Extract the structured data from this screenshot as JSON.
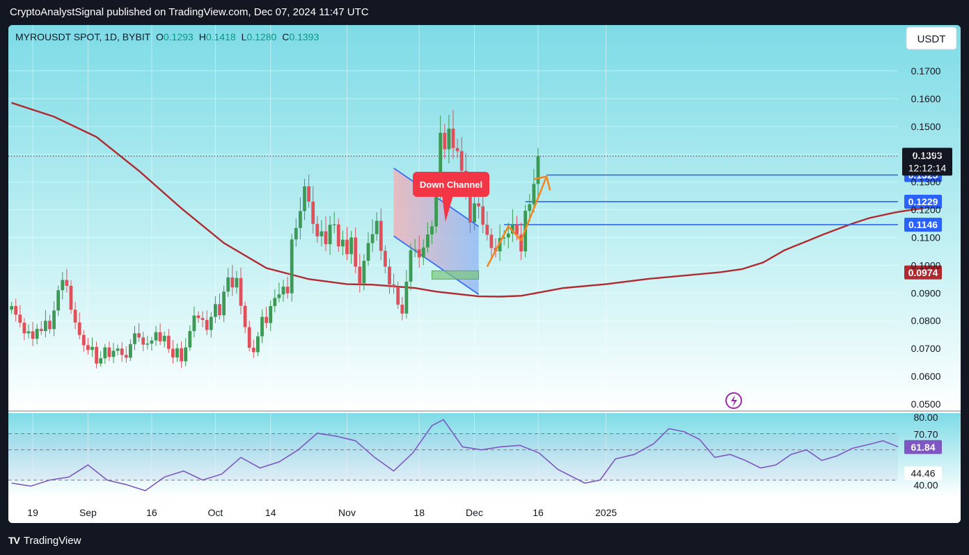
{
  "header": {
    "text": "CryptoAnalystSignal published on TradingView.com, Dec 07, 2024 11:47 UTC"
  },
  "footer": {
    "brand": "TradingView"
  },
  "legend": {
    "symbol": "MYROUSDT SPOT, 1D, BYBIT",
    "o_label": "O",
    "o_value": "0.1293",
    "h_label": "H",
    "h_value": "0.1418",
    "l_label": "L",
    "l_value": "0.1280",
    "c_label": "C",
    "c_value": "0.1393"
  },
  "currency_button": "USDT",
  "annotation_label": "Down Channel",
  "colors": {
    "bull": "#26a69a",
    "bull_dark": "#3c9a55",
    "bear": "#e0505a",
    "ma": "#b02a30",
    "level": "#2962ff",
    "arrow": "#f5851f",
    "rsi": "#7e57c2"
  },
  "chart_data": {
    "type": "candlestick",
    "price_axis": {
      "ylim": [
        0.048,
        0.182
      ],
      "ticks": [
        "0.0500",
        "0.0600",
        "0.0700",
        "0.0800",
        "0.0900",
        "0.1000",
        "0.1100",
        "0.1200",
        "0.1300",
        "0.1400",
        "0.1500",
        "0.1600",
        "0.1700"
      ]
    },
    "time_axis": {
      "labels": [
        {
          "text": "19",
          "date": "2024-08-19"
        },
        {
          "text": "Sep",
          "date": "2024-09-01"
        },
        {
          "text": "16",
          "date": "2024-09-16"
        },
        {
          "text": "Oct",
          "date": "2024-10-01"
        },
        {
          "text": "14",
          "date": "2024-10-14"
        },
        {
          "text": "Nov",
          "date": "2024-11-01"
        },
        {
          "text": "18",
          "date": "2024-11-18"
        },
        {
          "text": "Dec",
          "date": "2024-12-01"
        },
        {
          "text": "16",
          "date": "2024-12-16"
        },
        {
          "text": "2025",
          "date": "2025-01-01"
        }
      ]
    },
    "closes": [
      0.0853,
      0.0822,
      0.0793,
      0.0755,
      0.0762,
      0.0735,
      0.0771,
      0.0763,
      0.08,
      0.077,
      0.0837,
      0.091,
      0.0947,
      0.0926,
      0.084,
      0.0794,
      0.0749,
      0.0712,
      0.0695,
      0.0706,
      0.0646,
      0.0665,
      0.0704,
      0.067,
      0.0692,
      0.07,
      0.0677,
      0.0667,
      0.0716,
      0.0755,
      0.074,
      0.0714,
      0.0718,
      0.0729,
      0.0759,
      0.0726,
      0.0746,
      0.0699,
      0.0668,
      0.0701,
      0.0654,
      0.0704,
      0.0763,
      0.0819,
      0.081,
      0.0803,
      0.0767,
      0.0814,
      0.086,
      0.082,
      0.0905,
      0.0956,
      0.092,
      0.0954,
      0.0854,
      0.0777,
      0.0703,
      0.0687,
      0.0744,
      0.0814,
      0.0792,
      0.0853,
      0.0882,
      0.0895,
      0.0923,
      0.0899,
      0.1093,
      0.1134,
      0.1195,
      0.1284,
      0.1229,
      0.1149,
      0.1104,
      0.1122,
      0.1076,
      0.1146,
      0.1147,
      0.1068,
      0.1092,
      0.104,
      0.11,
      0.0995,
      0.0935,
      0.1016,
      0.108,
      0.1112,
      0.116,
      0.1052,
      0.0995,
      0.0931,
      0.0922,
      0.0858,
      0.0826,
      0.0941,
      0.1054,
      0.1057,
      0.1028,
      0.1064,
      0.1111,
      0.114,
      0.128,
      0.1477,
      0.1418,
      0.1492,
      0.1422,
      0.1411,
      0.134,
      0.1262,
      0.1154,
      0.1223,
      0.1212,
      0.1146,
      0.111,
      0.1062,
      0.105,
      0.1098,
      0.11,
      0.1114,
      0.1147,
      0.111,
      0.105,
      0.1196,
      0.122,
      0.1293,
      0.1393
    ],
    "candle_start": "2024-08-14",
    "levels": [
      {
        "value": 0.1325,
        "label": "0.1325"
      },
      {
        "value": 0.1229,
        "label": "0.1229"
      },
      {
        "value": 0.1146,
        "label": "0.1146"
      }
    ],
    "last_price": {
      "value": 0.1393,
      "label": "0.1393",
      "countdown": "12:12:14"
    },
    "moving_average": {
      "value": 0.0974,
      "label": "0.0974",
      "points": [
        [
          0,
          0.1585
        ],
        [
          10,
          0.1535
        ],
        [
          20,
          0.1462
        ],
        [
          30,
          0.134
        ],
        [
          40,
          0.1205
        ],
        [
          50,
          0.108
        ],
        [
          60,
          0.099
        ],
        [
          70,
          0.095
        ],
        [
          79,
          0.0932
        ],
        [
          85,
          0.093
        ],
        [
          95,
          0.0918
        ],
        [
          100,
          0.0905
        ],
        [
          110,
          0.0888
        ],
        [
          115,
          0.0887
        ],
        [
          120,
          0.089
        ],
        [
          130,
          0.0918
        ],
        [
          140,
          0.0932
        ],
        [
          150,
          0.0951
        ],
        [
          160,
          0.0965
        ],
        [
          167,
          0.0975
        ],
        [
          172,
          0.0986
        ],
        [
          177,
          0.101
        ],
        [
          182,
          0.1054
        ],
        [
          187,
          0.1085
        ],
        [
          191,
          0.111
        ],
        [
          195,
          0.1133
        ],
        [
          198,
          0.115
        ],
        [
          202,
          0.117
        ],
        [
          208,
          0.119
        ],
        [
          212,
          0.12
        ],
        [
          217,
          0.121
        ]
      ]
    },
    "rsi": {
      "axis_labels": [
        "80.00",
        "70.70",
        "40.00"
      ],
      "value_labels": [
        "61.84",
        "44.46"
      ],
      "points": [
        [
          0,
          38
        ],
        [
          5,
          36
        ],
        [
          10,
          40
        ],
        [
          15,
          42
        ],
        [
          20,
          50
        ],
        [
          25,
          40
        ],
        [
          30,
          37
        ],
        [
          35,
          33
        ],
        [
          40,
          42
        ],
        [
          45,
          46
        ],
        [
          50,
          40
        ],
        [
          55,
          44
        ],
        [
          60,
          55
        ],
        [
          65,
          48
        ],
        [
          70,
          52
        ],
        [
          75,
          60
        ],
        [
          80,
          71
        ],
        [
          85,
          69
        ],
        [
          90,
          66
        ],
        [
          95,
          55
        ],
        [
          100,
          46
        ],
        [
          105,
          58
        ],
        [
          110,
          76
        ],
        [
          113,
          80
        ],
        [
          118,
          62
        ],
        [
          123,
          60
        ],
        [
          128,
          62
        ],
        [
          133,
          63
        ],
        [
          138,
          58
        ],
        [
          143,
          47
        ],
        [
          150,
          38
        ],
        [
          154,
          40
        ],
        [
          158,
          54
        ],
        [
          163,
          57
        ],
        [
          168,
          64
        ],
        [
          172,
          74
        ],
        [
          176,
          72
        ],
        [
          180,
          67
        ],
        [
          184,
          55
        ],
        [
          188,
          57
        ],
        [
          192,
          53
        ],
        [
          196,
          48
        ],
        [
          200,
          50
        ],
        [
          204,
          57
        ],
        [
          208,
          60
        ],
        [
          212,
          53
        ],
        [
          216,
          56
        ],
        [
          220,
          61
        ],
        [
          225,
          64
        ],
        [
          228,
          66
        ],
        [
          232,
          62
        ]
      ]
    },
    "rsi_ylim": [
      30,
      82
    ],
    "rsi_bands": [
      70.7,
      60.0,
      40.0
    ]
  }
}
